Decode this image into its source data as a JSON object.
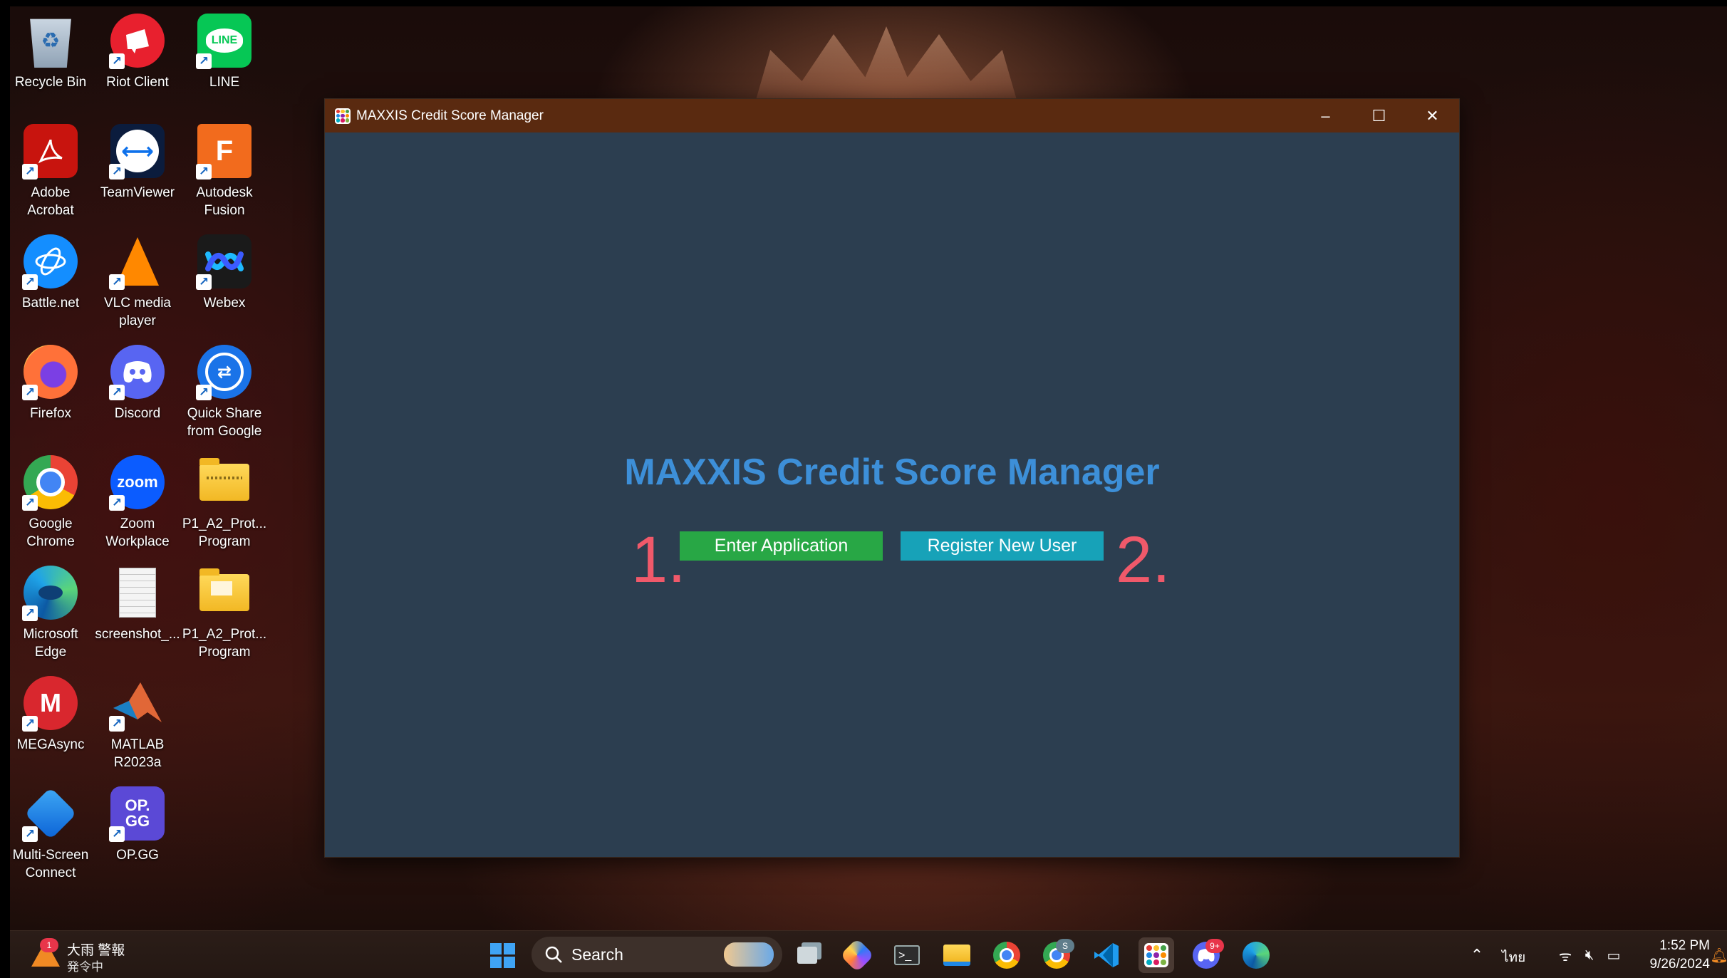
{
  "desktop": {
    "icons": [
      {
        "label": "Recycle Bin",
        "icon": "recycle-bin-icon"
      },
      {
        "label": "Riot Client",
        "icon": "riot-client-icon"
      },
      {
        "label": "LINE",
        "icon": "line-icon",
        "text": "LINE"
      },
      {
        "label": "Adobe\nAcrobat",
        "icon": "adobe-acrobat-icon"
      },
      {
        "label": "TeamViewer",
        "icon": "teamviewer-icon"
      },
      {
        "label": "Autodesk\nFusion",
        "icon": "autodesk-fusion-icon",
        "text": "F"
      },
      {
        "label": "Battle.net",
        "icon": "battlenet-icon"
      },
      {
        "label": "VLC media\nplayer",
        "icon": "vlc-icon"
      },
      {
        "label": "Webex",
        "icon": "webex-icon"
      },
      {
        "label": "Firefox",
        "icon": "firefox-icon"
      },
      {
        "label": "Discord",
        "icon": "discord-icon"
      },
      {
        "label": "Quick Share\nfrom Google",
        "icon": "quick-share-icon"
      },
      {
        "label": "Google\nChrome",
        "icon": "chrome-icon"
      },
      {
        "label": "Zoom\nWorkplace",
        "icon": "zoom-icon",
        "text": "zoom"
      },
      {
        "label": "P1_A2_Prot...\nProgram",
        "icon": "folder-zip-icon"
      },
      {
        "label": "Microsoft\nEdge",
        "icon": "edge-icon"
      },
      {
        "label": "screenshot_...",
        "icon": "document-icon"
      },
      {
        "label": "P1_A2_Prot...\nProgram",
        "icon": "folder-icon"
      },
      {
        "label": "MEGAsync",
        "icon": "megasync-icon",
        "text": "M"
      },
      {
        "label": "MATLAB\nR2023a",
        "icon": "matlab-icon"
      },
      {
        "label": "Multi-Screen\nConnect",
        "icon": "multi-screen-connect-icon"
      },
      {
        "label": "OP.GG",
        "icon": "opgg-icon",
        "text": "OP.\nGG"
      }
    ]
  },
  "window": {
    "title": "MAXXIS Credit Score Manager",
    "heading": "MAXXIS Credit Score Manager",
    "enter_button": "Enter Application",
    "register_button": "Register New User",
    "annotation_1": "1.",
    "annotation_2": "2.",
    "controls": {
      "minimize": "–",
      "maximize": "☐",
      "close": "✕"
    }
  },
  "taskbar": {
    "weather_title": "大雨 警報",
    "weather_sub": "発令中",
    "weather_badge": "1",
    "search_label": "Search",
    "discord_badge": "9+",
    "chrome_badge": "S",
    "tray_lang": "ไทย",
    "time": "1:52 PM",
    "date": "9/26/2024"
  },
  "colors": {
    "window_bg": "#2c3e50",
    "titlebar": "#5a2a10",
    "heading": "#3d8fd8",
    "enter_button": "#28a745",
    "register_button": "#17a2b8",
    "annotation": "#f0596a"
  }
}
